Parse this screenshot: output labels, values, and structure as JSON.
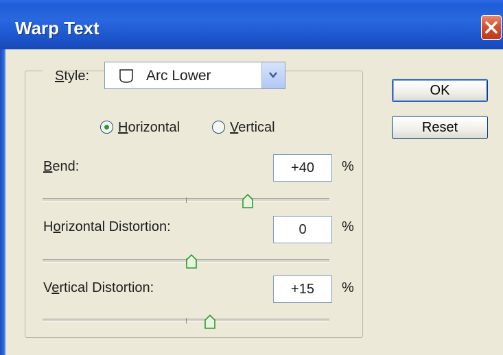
{
  "dialog": {
    "title": "Warp Text"
  },
  "style": {
    "label": "Style:",
    "value": "Arc Lower",
    "icon": "arc-lower-shape-icon"
  },
  "orientation": {
    "options": [
      "Horizontal",
      "Vertical"
    ],
    "selected": "Horizontal"
  },
  "bend": {
    "label": "Bend:",
    "value": "+40",
    "unit": "%",
    "slider_value": 40
  },
  "horizontal_distortion": {
    "label": "Horizontal Distortion:",
    "value": "0",
    "unit": "%",
    "slider_value": 0
  },
  "vertical_distortion": {
    "label": "Vertical Distortion:",
    "value": "+15",
    "unit": "%",
    "slider_value": 15
  },
  "buttons": {
    "ok": "OK",
    "reset": "Reset"
  },
  "colors": {
    "title_bar": "#2a68e0",
    "close_button": "#d8502c",
    "dialog_background": "#ece9d8",
    "radio_dot": "#2e9a2e",
    "slider_thumb": "#2e9a2e"
  }
}
